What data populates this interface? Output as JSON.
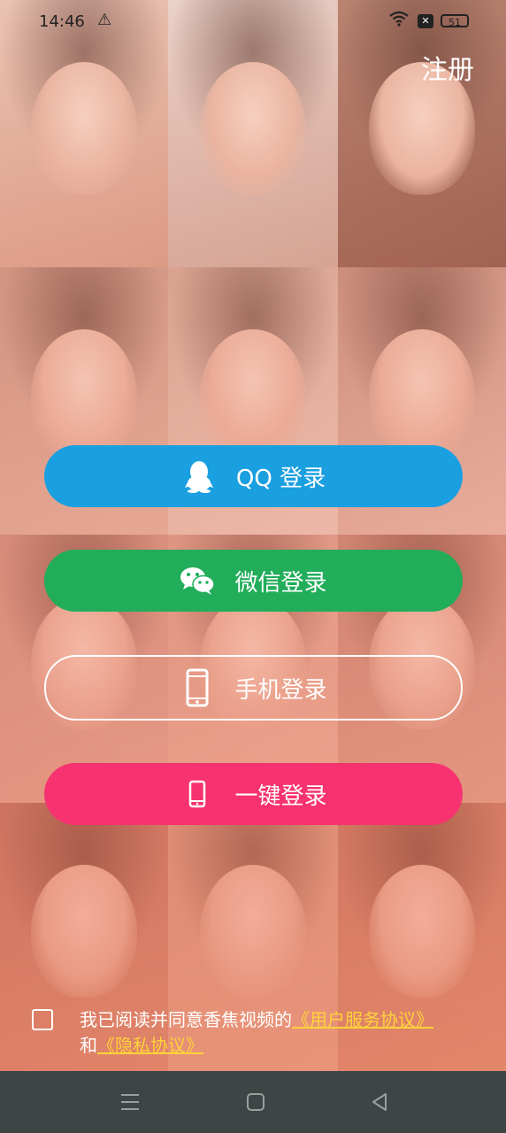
{
  "status_bar": {
    "time": "14:46",
    "battery": "51",
    "sim_badge": "✕"
  },
  "header": {
    "register_label": "注册"
  },
  "login_buttons": {
    "qq": "QQ 登录",
    "wechat": "微信登录",
    "phone": "手机登录",
    "one_key": "一键登录"
  },
  "agreement": {
    "prefix": "我已阅读并同意香焦视频的",
    "user_service_link": "《用户服务协议》",
    "conjunction": "和",
    "privacy_link": "《隐私协议》",
    "checked": false
  },
  "colors": {
    "qq": "#1a9fe0",
    "wechat": "#22ad5a",
    "one_key": "#f73270",
    "link": "#ffd23a",
    "navbar": "#3f4544"
  },
  "icons": {
    "qq": "qq-penguin-icon",
    "wechat": "wechat-icon",
    "phone": "mobile-phone-icon",
    "one_key": "mobile-phone-icon",
    "nav_menu": "menu-icon",
    "nav_home": "home-square-icon",
    "nav_back": "back-triangle-icon"
  }
}
